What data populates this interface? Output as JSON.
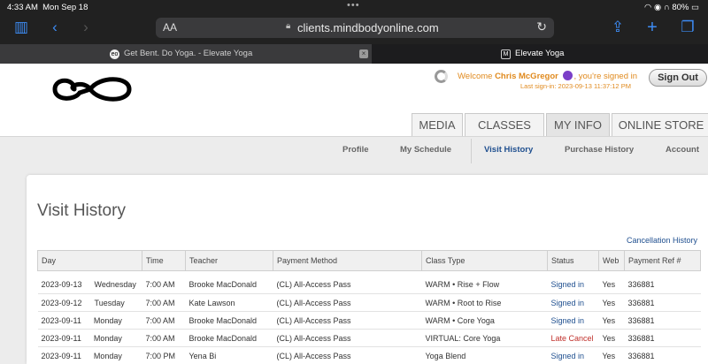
{
  "status_bar": {
    "time": "4:33 AM",
    "date": "Mon Sep 18",
    "dots": "•••",
    "battery": "80%"
  },
  "browser": {
    "aa_label": "AA",
    "url": "clients.mindbodyonline.com",
    "tabs": [
      {
        "title": "Get Bent. Do Yoga. - Elevate Yoga",
        "favicon": "eo"
      },
      {
        "title": "Elevate Yoga",
        "favicon": "M"
      }
    ],
    "icons": [
      "sidebar-icon",
      "back-icon",
      "forward-icon",
      "lock-icon",
      "reload-icon",
      "share-icon",
      "new-tab-icon",
      "tabs-icon"
    ]
  },
  "header": {
    "welcome_prefix": "Welcome ",
    "user_name": "Chris McGregor",
    "welcome_suffix": ", you're signed in",
    "last_signin": "Last sign-in: 2023-09-13 11:37:12 PM",
    "signout_label": "Sign Out",
    "accent_color": "#e08a1e",
    "avatar_color": "#7b3fc8"
  },
  "nav": {
    "tabs": [
      {
        "label": "MEDIA",
        "active": false
      },
      {
        "label": "CLASSES",
        "active": false
      },
      {
        "label": "MY INFO",
        "active": true
      },
      {
        "label": "ONLINE STORE",
        "active": false
      }
    ],
    "subnav": [
      {
        "label": "Profile",
        "active": false
      },
      {
        "label": "My Schedule",
        "active": false
      },
      {
        "label": "Visit History",
        "active": true
      },
      {
        "label": "Purchase History",
        "active": false
      },
      {
        "label": "Account",
        "active": false
      }
    ]
  },
  "page": {
    "title": "Visit History",
    "cancellation_link": "Cancellation History"
  },
  "table": {
    "columns": [
      "Day",
      "Time",
      "Teacher",
      "Payment Method",
      "Class Type",
      "Status",
      "Web",
      "Payment Ref #"
    ],
    "rows": [
      [
        "2023-09-13",
        "Wednesday",
        "7:00 AM",
        "Brooke MacDonald",
        "(CL) All-Access Pass",
        "WARM • Rise + Flow",
        "Signed in",
        "Yes",
        "336881"
      ],
      [
        "2023-09-12",
        "Tuesday",
        "7:00 AM",
        "Kate Lawson",
        "(CL) All-Access Pass",
        "WARM • Root to Rise",
        "Signed in",
        "Yes",
        "336881"
      ],
      [
        "2023-09-11",
        "Monday",
        "7:00 AM",
        "Brooke MacDonald",
        "(CL) All-Access Pass",
        "WARM • Core Yoga",
        "Signed in",
        "Yes",
        "336881"
      ],
      [
        "2023-09-11",
        "Monday",
        "7:00 AM",
        "Brooke MacDonald",
        "(CL) All-Access Pass",
        "VIRTUAL: Core Yoga",
        "Late Cancel",
        "Yes",
        "336881"
      ],
      [
        "2023-09-11",
        "Monday",
        "7:00 PM",
        "Yena Bi",
        "(CL) All-Access Pass",
        "Yoga Blend",
        "Signed in",
        "Yes",
        "336881"
      ]
    ],
    "status_colors": {
      "Signed in": "#1f4f8f",
      "Late Cancel": "#c0302b"
    }
  }
}
